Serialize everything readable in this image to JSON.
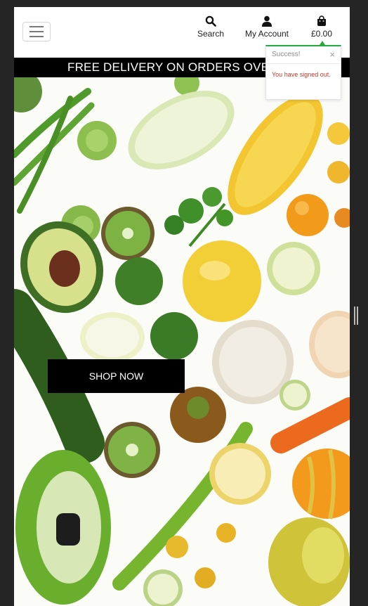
{
  "header": {
    "search_label": "Search",
    "account_label": "My Account",
    "cart_total": "£0.00"
  },
  "banner": {
    "text": "FREE DELIVERY ON ORDERS OVER"
  },
  "hero": {
    "cta_label": "SHOP NOW"
  },
  "toast": {
    "title": "Success!",
    "close": "×",
    "message": "You have signed out."
  },
  "colors": {
    "success": "#28a745",
    "error_text": "#c0392b",
    "banner_bg": "#000000"
  }
}
